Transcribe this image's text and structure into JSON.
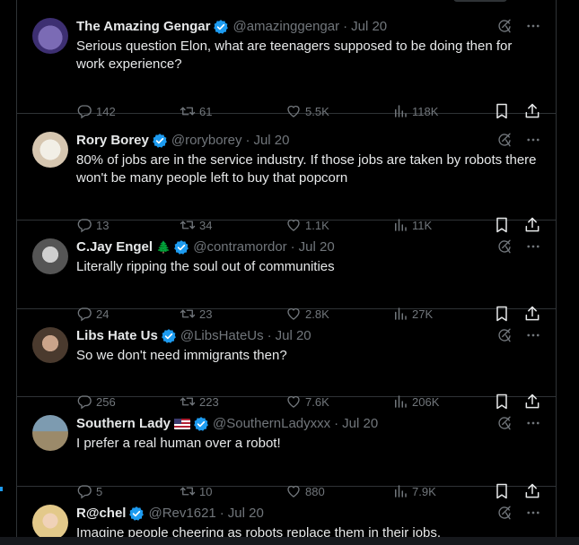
{
  "colors": {
    "accent": "#1d9bf0",
    "muted": "#71767b",
    "text": "#e7e9ea",
    "divider": "#2f3336"
  },
  "tweets": [
    {
      "name": "The Amazing Gengar",
      "handle": "@amazinggengar",
      "sep": "·",
      "time": "Jul 20",
      "text": "Serious question Elon, what are teenagers supposed to be doing then for work experience?",
      "replies": "142",
      "retweets": "61",
      "likes": "5.5K",
      "views": "118K",
      "avatar_icon": "gengar-avatar"
    },
    {
      "name": "Rory Borey",
      "handle": "@roryborey",
      "sep": "·",
      "time": "Jul 20",
      "text": "80% of jobs are in the service industry. If those jobs are taken by robots there won't be many people left to buy that popcorn",
      "replies": "13",
      "retweets": "34",
      "likes": "1.1K",
      "views": "11K",
      "avatar_icon": "cat-avatar"
    },
    {
      "name": "C.Jay Engel",
      "emoji": "🌲",
      "handle": "@contramordor",
      "sep": "·",
      "time": "Jul 20",
      "text": "Literally ripping the soul out of communities",
      "replies": "24",
      "retweets": "23",
      "likes": "2.8K",
      "views": "27K",
      "avatar_icon": "person-avatar"
    },
    {
      "name": "Libs Hate Us",
      "handle": "@LibsHateUs",
      "sep": "·",
      "time": "Jul 20",
      "text": "So we don't need immigrants then?",
      "replies": "256",
      "retweets": "223",
      "likes": "7.6K",
      "views": "206K",
      "avatar_icon": "person-avatar"
    },
    {
      "name": "Southern Lady",
      "flag_icon": "us-flag-icon",
      "handle": "@SouthernLadyxxx",
      "sep": "·",
      "time": "Jul 20",
      "text": "I prefer a real human over a robot!",
      "replies": "5",
      "retweets": "10",
      "likes": "880",
      "views": "7.9K",
      "avatar_icon": "house-avatar"
    },
    {
      "name": "R@chel",
      "handle": "@Rev1621",
      "sep": "·",
      "time": "Jul 20",
      "text": "Imagine people cheering as robots replace them in their jobs.",
      "avatar_icon": "person-avatar"
    }
  ]
}
